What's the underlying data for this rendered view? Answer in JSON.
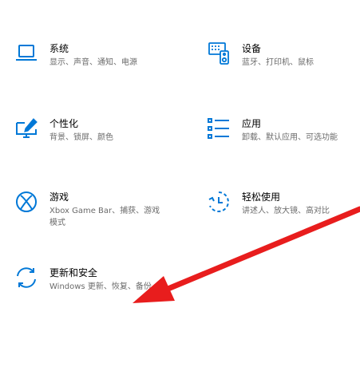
{
  "settings": {
    "tiles": [
      {
        "icon": "laptop-icon",
        "title": "系统",
        "desc": "显示、声音、通知、电源"
      },
      {
        "icon": "devices-icon",
        "title": "设备",
        "desc": "蓝牙、打印机、鼠标"
      },
      {
        "icon": "personalization-icon",
        "title": "个性化",
        "desc": "背景、锁屏、颜色"
      },
      {
        "icon": "apps-icon",
        "title": "应用",
        "desc": "卸载、默认应用、可选功能"
      },
      {
        "icon": "xbox-icon",
        "title": "游戏",
        "desc_line1": "Xbox Game Bar、捕获、游戏",
        "desc_line2": "模式"
      },
      {
        "icon": "ease-of-access-icon",
        "title": "轻松使用",
        "desc": "讲述人、放大镜、高对比"
      },
      {
        "icon": "update-sync-icon",
        "title": "更新和安全",
        "desc": "Windows 更新、恢复、备份"
      }
    ],
    "accent_color": "#0078d7",
    "annotation_color": "#e81d1d"
  }
}
